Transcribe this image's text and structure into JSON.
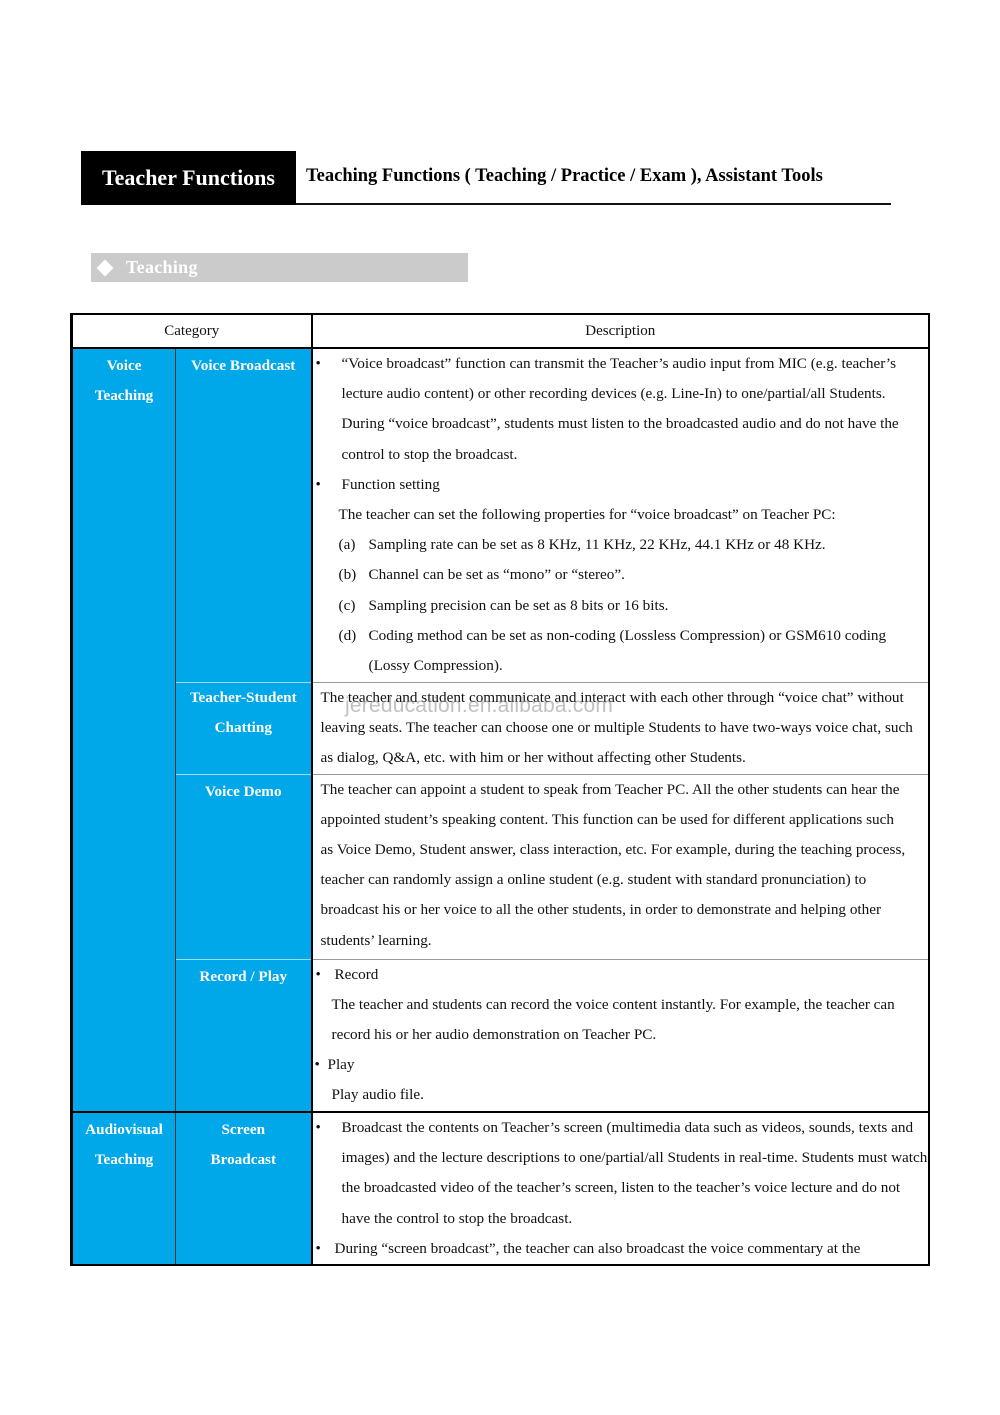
{
  "header": {
    "title": "Teacher Functions",
    "subtitle": "Teaching Functions ( Teaching / Practice / Exam ), Assistant Tools"
  },
  "section": {
    "icon": "diamond-icon",
    "label": "Teaching"
  },
  "table": {
    "columns": [
      "Category",
      "Description"
    ],
    "groups": [
      {
        "category": [
          "Voice",
          "Teaching"
        ],
        "rows": [
          {
            "name": "Voice Broadcast",
            "bullets": [
              {
                "bullet": "•",
                "text": "“Voice broadcast” function can transmit the Teacher’s audio input from MIC (e.g. teacher’s lecture audio content) or other recording devices (e.g. Line-In) to one/partial/all Students. During “voice broadcast”, students must listen to the broadcasted audio and do not have the control to stop the broadcast."
              },
              {
                "bullet": "•",
                "text": "Function setting",
                "detail": "The teacher can set the following properties for “voice broadcast” on Teacher PC:",
                "items": [
                  {
                    "label": "(a)",
                    "text": "Sampling rate can be set as 8 KHz, 11 KHz, 22 KHz, 44.1 KHz or 48 KHz."
                  },
                  {
                    "label": "(b)",
                    "text": "Channel can be set as “mono” or “stereo”."
                  },
                  {
                    "label": "(c)",
                    "text": "Sampling precision can be set as 8 bits or 16 bits."
                  },
                  {
                    "label": "(d)",
                    "text": "Coding method can be set as non-coding (Lossless Compression) or GSM610 coding (Lossy Compression)."
                  }
                ]
              }
            ]
          },
          {
            "name": "Teacher-Student Chatting",
            "text": "The teacher and student communicate and interact with each other through “voice chat” without leaving seats. The teacher can choose one or multiple Students to have two-ways voice chat, such as dialog, Q&A, etc. with him or her without affecting other Students."
          },
          {
            "name": "Voice Demo",
            "text": "The teacher can appoint a student to speak from Teacher PC. All the other students can hear the appointed student’s speaking content. This function can be used for different applications such as Voice Demo, Student answer, class interaction, etc. For example, during the teaching process, teacher can randomly assign a online student (e.g. student with standard pronunciation) to broadcast his or her voice to all the other students, in order to demonstrate and helping other students’ learning."
          },
          {
            "name": "Record / Play",
            "bullets": [
              {
                "bullet": "•",
                "text": "Record",
                "detail": "The teacher and students can record the voice content instantly. For example, the teacher can record his or her audio demonstration on Teacher PC."
              },
              {
                "bullet": "•",
                "text": "Play",
                "detail": "Play audio file."
              }
            ]
          }
        ]
      },
      {
        "category": [
          "Audiovisual",
          "Teaching"
        ],
        "rows": [
          {
            "name": "Screen Broadcast",
            "name_lines": [
              "Screen",
              "Broadcast"
            ],
            "bullets": [
              {
                "bullet": "•",
                "text": "Broadcast the contents on Teacher’s screen (multimedia data such as videos, sounds, texts and images) and the lecture descriptions to one/partial/all Students in real-time. Students must watch the broadcasted video of the teacher’s screen, listen to the teacher’s voice lecture and do not have the control to stop the broadcast."
              },
              {
                "bullet": "•",
                "text": "During “screen broadcast”, the teacher can also broadcast the voice commentary at the"
              }
            ]
          }
        ]
      }
    ]
  },
  "watermark": "jereducation.en.alibaba.com",
  "colors": {
    "category_fill": "#00a7e9",
    "section_bar": "#cbcbcb",
    "header_block": "#000000"
  }
}
